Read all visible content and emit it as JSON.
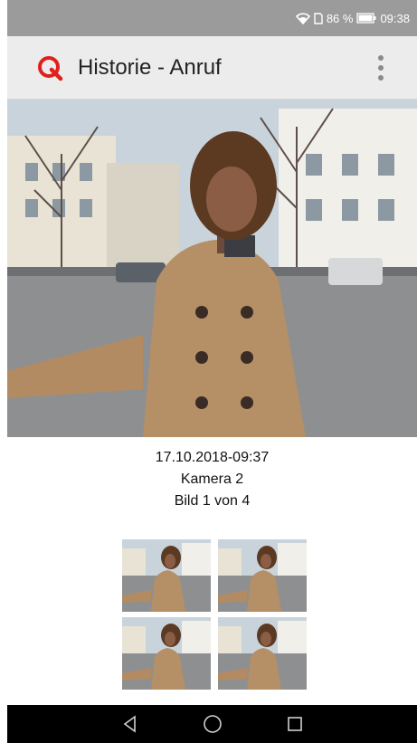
{
  "statusbar": {
    "icons": [
      "wifi-icon",
      "sim-icon",
      "battery-icon"
    ],
    "battery": "86 %",
    "time": "09:38"
  },
  "appbar": {
    "title": "Historie - Anruf",
    "logo_icon": "q-logo-icon",
    "menu_icon": "more-vert-icon",
    "accent_color": "#e0201b"
  },
  "image_info": {
    "datetime": "17.10.2018-09:37",
    "camera": "Kamera 2",
    "counter": "Bild 1 von 4"
  },
  "thumbnails": [
    {
      "name": "thumbnail-1"
    },
    {
      "name": "thumbnail-2"
    },
    {
      "name": "thumbnail-3"
    },
    {
      "name": "thumbnail-4"
    }
  ],
  "navbar": {
    "back_icon": "back-triangle-icon",
    "home_icon": "home-circle-icon",
    "recents_icon": "recents-square-icon"
  }
}
